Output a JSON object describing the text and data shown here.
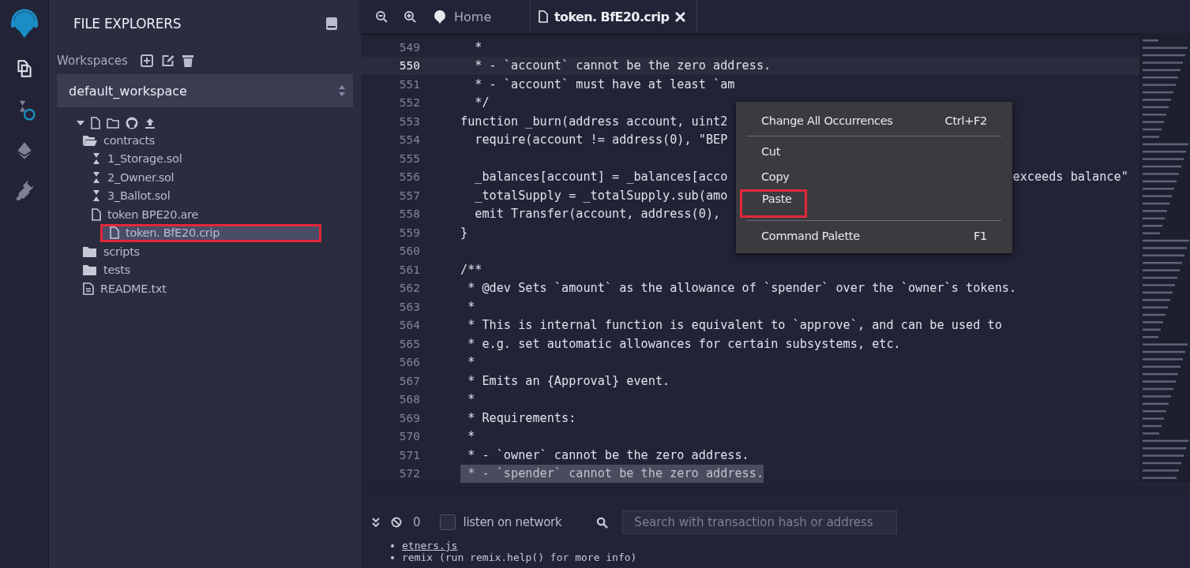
{
  "activity_bar": [
    {
      "kind": "files",
      "selected": true
    },
    {
      "kind": "compiler",
      "selected": false
    },
    {
      "kind": "deploy",
      "selected": false
    },
    {
      "kind": "plugins",
      "selected": false
    }
  ],
  "sidebar": {
    "title": "FILE EXPLORERS",
    "workspaces_label": "Workspaces",
    "workspace": "default_workspace",
    "tree": [
      {
        "kind": "folder",
        "name": "contracts",
        "expanded": true,
        "selected": false,
        "annotated": false,
        "children": [
          {
            "kind": "sol",
            "name": "1_Storage.sol",
            "selected": false,
            "annotated": false
          },
          {
            "kind": "sol",
            "name": "2_Owner.sol",
            "selected": false,
            "annotated": false
          },
          {
            "kind": "sol",
            "name": "3_Ballot.sol",
            "selected": false,
            "annotated": false
          },
          {
            "kind": "file",
            "name": "token BPE20.are",
            "selected": false,
            "annotated": false
          },
          {
            "kind": "file",
            "name": "token. BfE20.crip",
            "selected": true,
            "annotated": true
          }
        ]
      },
      {
        "kind": "folder",
        "name": "scripts",
        "expanded": false,
        "selected": false,
        "annotated": false
      },
      {
        "kind": "folder",
        "name": "tests",
        "expanded": false,
        "selected": false,
        "annotated": false
      },
      {
        "kind": "doc",
        "name": "README.txt",
        "selected": false,
        "annotated": false
      }
    ]
  },
  "tabs": [
    {
      "kind": "home",
      "label": "Home",
      "selected": false,
      "closable": false
    },
    {
      "kind": "file",
      "label": "token. BfE20.crip",
      "selected": true,
      "closable": true
    }
  ],
  "editor": {
    "lines": [
      {
        "number": "549",
        "text": "  *",
        "current": false,
        "selected": false
      },
      {
        "number": "550",
        "text": "  * - `account` cannot be the zero address.",
        "current": true,
        "selected": false
      },
      {
        "number": "551",
        "text": "  * - `account` must have at least `am",
        "current": false,
        "selected": false
      },
      {
        "number": "552",
        "text": "  */",
        "current": false,
        "selected": false
      },
      {
        "number": "553",
        "text": "function _burn(address account, uint2",
        "current": false,
        "selected": false
      },
      {
        "number": "554",
        "text": "  require(account != address(0), \"BEP",
        "current": false,
        "selected": false
      },
      {
        "number": "555",
        "current": false,
        "selected": false
      },
      {
        "number": "556",
        "text": "  _balances[account] = _balances[acco",
        "tail": "exceeds balance\"",
        "current": false,
        "selected": false
      },
      {
        "number": "557",
        "text": "  _totalSupply = _totalSupply.sub(amo",
        "current": false,
        "selected": false
      },
      {
        "number": "558",
        "text": "  emit Transfer(account, address(0), ",
        "current": false,
        "selected": false
      },
      {
        "number": "559",
        "text": "}",
        "current": false,
        "selected": false
      },
      {
        "number": "560",
        "current": false,
        "selected": false
      },
      {
        "number": "561",
        "text": "/**",
        "current": false,
        "selected": false
      },
      {
        "number": "562",
        "text": " * @dev Sets `amount` as the allowance of `spender` over the `owner`s tokens.",
        "current": false,
        "selected": false
      },
      {
        "number": "563",
        "text": " *",
        "current": false,
        "selected": false
      },
      {
        "number": "564",
        "text": " * This is internal function is equivalent to `approve`, and can be used to",
        "current": false,
        "selected": false
      },
      {
        "number": "565",
        "text": " * e.g. set automatic allowances for certain subsystems, etc.",
        "current": false,
        "selected": false
      },
      {
        "number": "566",
        "text": " *",
        "current": false,
        "selected": false
      },
      {
        "number": "567",
        "text": " * Emits an {Approval} event.",
        "current": false,
        "selected": false
      },
      {
        "number": "568",
        "text": " *",
        "current": false,
        "selected": false
      },
      {
        "number": "569",
        "text": " * Requirements:",
        "current": false,
        "selected": false
      },
      {
        "number": "570",
        "text": " *",
        "current": false,
        "selected": false
      },
      {
        "number": "571",
        "text": " * - `owner` cannot be the zero address.",
        "current": false,
        "selected": false
      },
      {
        "number": "572",
        "text": " * - `spender` cannot be the zero address.",
        "current": false,
        "selected": true
      }
    ]
  },
  "context_menu": {
    "groups": [
      [
        {
          "label": "Change All Occurrences",
          "shortcut": "Ctrl+F2",
          "annotated": false
        }
      ],
      [
        {
          "label": "Cut",
          "annotated": false
        },
        {
          "label": "Copy",
          "annotated": false
        },
        {
          "label": "Paste",
          "annotated": true
        }
      ],
      [
        {
          "label": "Command Palette",
          "shortcut": "F1",
          "annotated": false
        }
      ]
    ]
  },
  "terminal": {
    "pending_count": "0",
    "listen_on_network": false,
    "listen_label": "listen on network",
    "search": {
      "placeholder": "Search with transaction hash or address"
    },
    "log": [
      {
        "kind": "link",
        "text": "etners.js"
      },
      {
        "kind": "text",
        "text": "remix (run remix.help() for more info)"
      }
    ]
  }
}
